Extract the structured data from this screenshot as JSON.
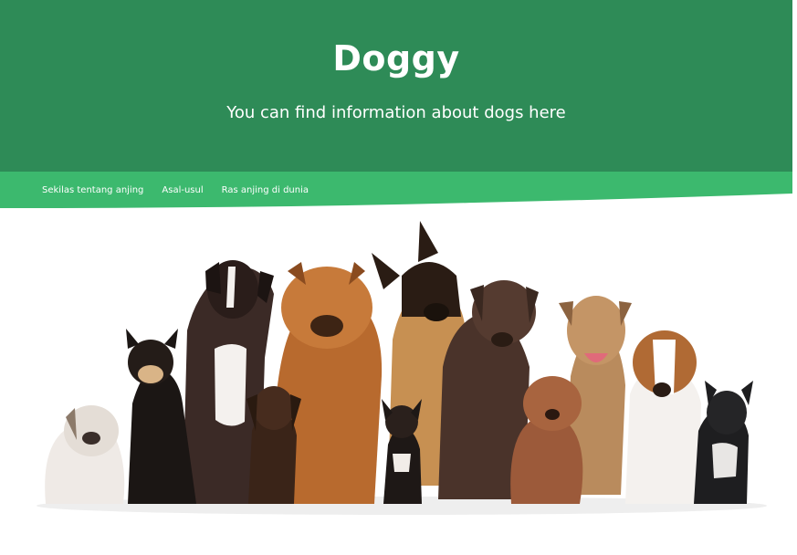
{
  "header": {
    "title": "Doggy",
    "subtitle": "You can find information about dogs here"
  },
  "nav": {
    "items": [
      {
        "label": "Sekilas tentang anjing"
      },
      {
        "label": "Asal-usul"
      },
      {
        "label": "Ras anjing di dunia"
      }
    ]
  },
  "colors": {
    "header_bg": "#2e8b57",
    "nav_bg": "#3cb96e",
    "text": "#ffffff"
  },
  "image": {
    "subject": "group-of-dogs-photo"
  }
}
